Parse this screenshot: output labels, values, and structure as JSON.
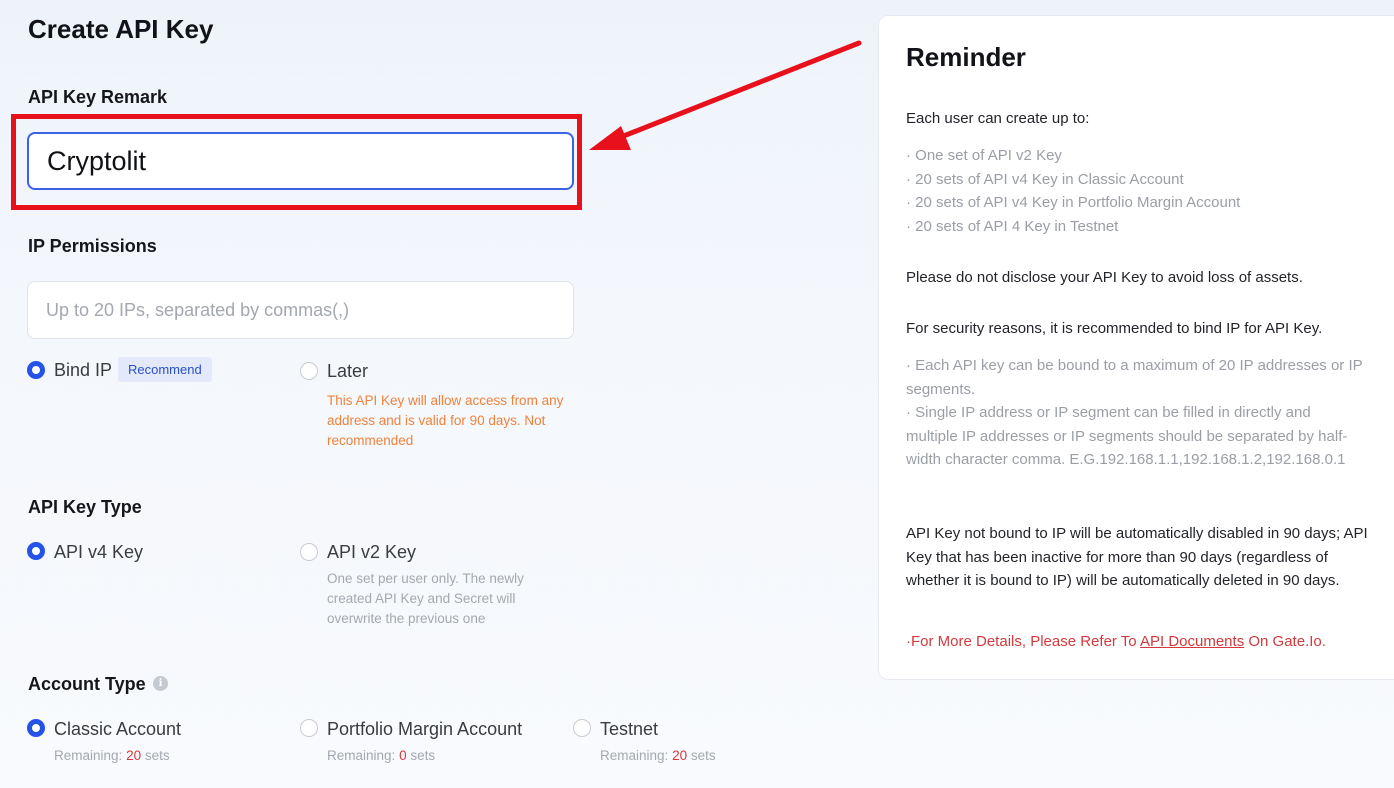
{
  "page_title": "Create API Key",
  "remark": {
    "label": "API Key Remark",
    "value": "Cryptolit"
  },
  "ip_permissions": {
    "label": "IP Permissions",
    "placeholder": "Up to 20 IPs, separated by commas(,)",
    "options": [
      {
        "label": "Bind IP",
        "tag": "Recommend",
        "selected": true
      },
      {
        "label": "Later",
        "selected": false,
        "note": "This API Key will allow access from any address and is valid for 90 days. Not recommended"
      }
    ]
  },
  "key_type": {
    "label": "API Key Type",
    "options": [
      {
        "label": "API v4 Key",
        "selected": true
      },
      {
        "label": "API v2 Key",
        "selected": false,
        "note": "One set per user only. The newly created API Key and Secret will overwrite the previous one"
      }
    ]
  },
  "account_type": {
    "label": "Account Type",
    "info_icon": "info-icon",
    "remaining_prefix": "Remaining:",
    "remaining_suffix": "sets",
    "options": [
      {
        "label": "Classic Account",
        "remaining": "20",
        "selected": true
      },
      {
        "label": "Portfolio Margin Account",
        "remaining": "0",
        "selected": false
      },
      {
        "label": "Testnet",
        "remaining": "20",
        "selected": false
      }
    ]
  },
  "reminder": {
    "title": "Reminder",
    "intro": "Each user can create up to:",
    "limits": [
      "· One set of API v2 Key",
      "· 20 sets of API v4 Key in Classic Account",
      "· 20 sets of API v4 Key in Portfolio Margin Account",
      "· 20 sets of API 4 Key in Testnet"
    ],
    "disclose": "Please do not disclose your API Key to avoid loss of assets.",
    "security": "For security reasons, it is recommended to bind IP for API Key.",
    "ip_rule_1": "· Each API key can be bound to a maximum of 20 IP addresses or IP segments.",
    "ip_rule_2": "· Single IP address or IP segment can be filled in directly and multiple IP addresses or IP segments should be separated by half-width character comma. E.G.192.168.1.1,192.168.1.2,192.168.0.1",
    "expiry": "API Key not bound to IP will be automatically disabled in 90 days; API Key that has been inactive for more than 90 days (regardless of whether it is bound to IP) will be automatically deleted in 90 days.",
    "details_prefix": "·For More Details, Please Refer To ",
    "details_link": "API Documents",
    "details_suffix": " On Gate.Io."
  },
  "colors": {
    "accent": "#2553ea",
    "annotation": "#e8111b",
    "warning": "#f0823a",
    "danger": "#d23a3d"
  }
}
